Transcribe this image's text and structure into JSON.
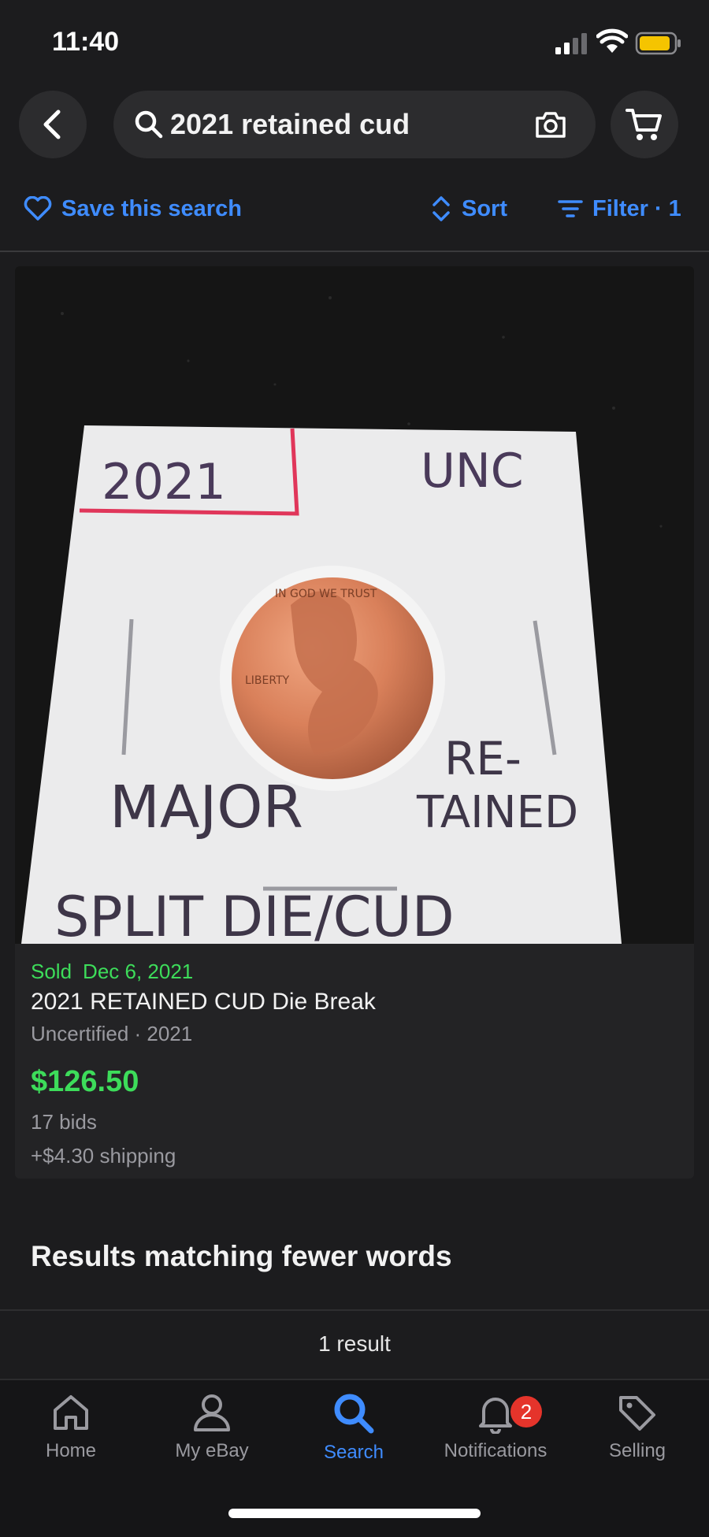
{
  "status": {
    "time": "11:40"
  },
  "search": {
    "query": "2021 retained cud"
  },
  "actions": {
    "save": "Save this search",
    "sort": "Sort",
    "filter": "Filter · 1"
  },
  "listing": {
    "sold_label": "Sold",
    "sold_date": "Dec 6, 2021",
    "title": "2021 RETAINED CUD Die Break",
    "subtitle": "Uncertified · 2021",
    "price": "$126.50",
    "bids": "17 bids",
    "shipping": "+$4.30 shipping",
    "photo_text": {
      "year": "2021",
      "grade": "UNC",
      "coin_top": "IN GOD WE TRUST",
      "coin_left": "LIBERTY",
      "line1": "MAJOR",
      "line2a": "RE-",
      "line2b": "TAINED",
      "line3": "SPLIT DIE/CUD"
    }
  },
  "section": {
    "fewer_words": "Results matching fewer words",
    "result_count": "1 result"
  },
  "tabs": [
    {
      "label": "Home",
      "icon": "home-icon"
    },
    {
      "label": "My eBay",
      "icon": "person-icon"
    },
    {
      "label": "Search",
      "icon": "search-icon"
    },
    {
      "label": "Notifications",
      "icon": "bell-icon",
      "badge": "2"
    },
    {
      "label": "Selling",
      "icon": "tag-icon"
    }
  ],
  "colors": {
    "accent": "#3f8cff",
    "sold_green": "#3ddc5a",
    "badge_red": "#e5342b",
    "background": "#1c1c1e"
  }
}
